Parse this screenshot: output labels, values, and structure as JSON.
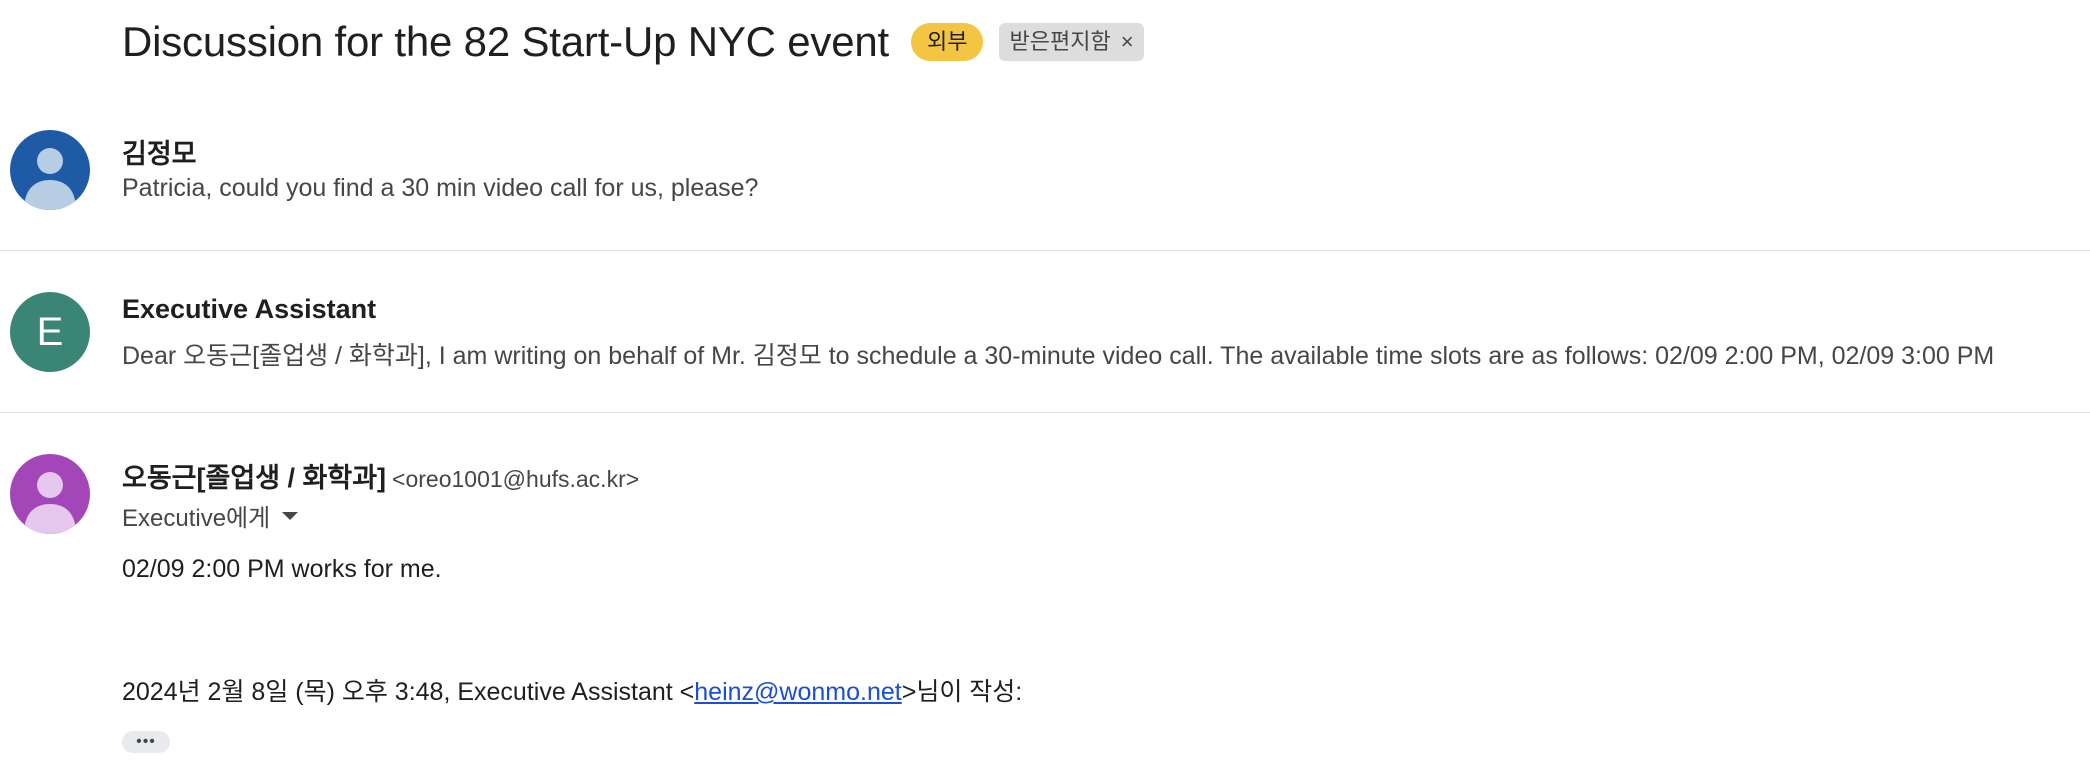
{
  "thread": {
    "subject": "Discussion for the 82 Start-Up NYC event",
    "badge_external": "외부",
    "badge_inbox": "받은편지함",
    "badge_close_icon": "×"
  },
  "colors": {
    "badge_external_bg": "#f4c542",
    "avatar1_bg": "#1f5aa6",
    "avatar2_bg": "#3b8577",
    "avatar3_bg": "#a347b8",
    "link": "#1a4fd0"
  },
  "messages": [
    {
      "sender": "김정모",
      "snippet": "Patricia, could you find a 30 min video call for us, please?",
      "avatar_icon": "person-icon"
    },
    {
      "sender": "Executive Assistant",
      "avatar_letter": "E",
      "snippet": "Dear 오동근[졸업생 / 화학과], I am writing on behalf of Mr. 김정모 to schedule a 30-minute video call. The available time slots are as follows: 02/09 2:00 PM, 02/09 3:00 PM"
    },
    {
      "sender": "오동근[졸업생 / 화학과]",
      "email": "<oreo1001@hufs.ac.kr>",
      "to": "Executive에게",
      "body": "02/09 2:00 PM works for me.",
      "quote_prefix": "2024년 2월 8일 (목) 오후 3:48, Executive Assistant <",
      "quote_link": "heinz@wonmo.net",
      "quote_suffix": ">님이 작성:",
      "expand_label": "•••",
      "avatar_icon": "person-icon"
    }
  ]
}
